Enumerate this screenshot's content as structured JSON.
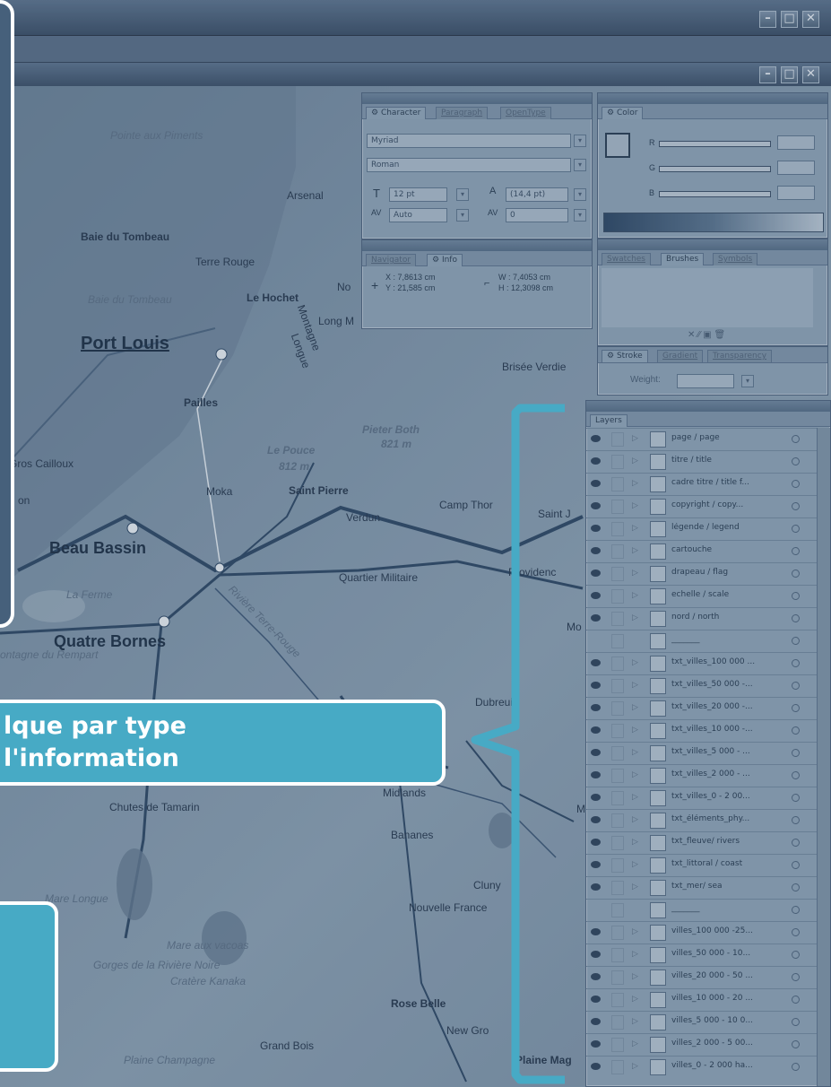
{
  "colors": {
    "accent": "#47aac5",
    "overlay": "#2e3e52"
  },
  "callout": {
    "line1": "lque par type",
    "line2": "l'information"
  },
  "panels": {
    "character": {
      "tabs": [
        "Character",
        "Paragraph",
        "OpenType"
      ],
      "font": "Myriad",
      "style": "Roman",
      "size": "12 pt",
      "leading": "(14,4 pt)",
      "kerning": "Auto",
      "tracking": "0"
    },
    "color": {
      "tab": "Color",
      "channels": [
        "R",
        "G",
        "B"
      ]
    },
    "info": {
      "tabs": [
        "Navigator",
        "Info"
      ],
      "x": "X : 7,8613 cm",
      "y": "Y : 21,585 cm",
      "w": "W : 7,4053 cm",
      "h": "H : 12,3098 cm"
    },
    "swatches": {
      "tabs": [
        "Swatches",
        "Brushes",
        "Symbols"
      ]
    },
    "stroke": {
      "tabs": [
        "Stroke",
        "Gradient",
        "Transparency"
      ],
      "weight_label": "Weight:"
    },
    "layers": {
      "tab": "Layers",
      "items": [
        "page / page",
        "titre / title",
        "cadre titre / title f...",
        "copyright / copy...",
        "légende / legend",
        "cartouche",
        "drapeau / flag",
        "echelle / scale",
        "nord / north",
        "_______",
        "txt_villes_100 000 ...",
        "txt_villes_50 000 -...",
        "txt_villes_20 000 -...",
        "txt_villes_10 000 -...",
        "txt_villes_5 000 - ...",
        "txt_villes_2 000 - ...",
        "txt_villes_0 - 2 00...",
        "txt_éléments_phy...",
        "txt_fleuve/ rivers",
        "txt_littoral / coast",
        "txt_mer/ sea",
        "_______",
        "villes_100 000 -25...",
        "villes_50 000 - 10...",
        "villes_20 000 - 50 ...",
        "villes_10 000 - 20 ...",
        "villes_5 000 - 10 0...",
        "villes_2 000 - 5 00...",
        "villes_0 - 2 000 ha..."
      ]
    }
  },
  "map_labels": [
    {
      "t": "Pointe aux Piments",
      "c": "i"
    },
    {
      "t": "Arsenal",
      "c": ""
    },
    {
      "t": "Baie du Tombeau",
      "c": "b"
    },
    {
      "t": "Terre Rouge",
      "c": ""
    },
    {
      "t": "Baie du Tombeau",
      "c": "i"
    },
    {
      "t": "Le Hochet",
      "c": "b"
    },
    {
      "t": "No",
      "c": ""
    },
    {
      "t": "Long M",
      "c": ""
    },
    {
      "t": "Port Louis",
      "c": "big"
    },
    {
      "t": "Montagne",
      "c": ""
    },
    {
      "t": "Longue",
      "c": ""
    },
    {
      "t": "Brisée Verdie",
      "c": ""
    },
    {
      "t": "Pailles",
      "c": "b"
    },
    {
      "t": "Pieter Both",
      "c": "bi"
    },
    {
      "t": "821 m",
      "c": "bi"
    },
    {
      "t": "Le Pouce",
      "c": "bi"
    },
    {
      "t": "812 m",
      "c": "bi"
    },
    {
      "t": "Gros Cailloux",
      "c": ""
    },
    {
      "t": "Moka",
      "c": ""
    },
    {
      "t": "Saint Pierre",
      "c": "b"
    },
    {
      "t": "Camp Thor",
      "c": ""
    },
    {
      "t": "Saint J",
      "c": ""
    },
    {
      "t": "Verdun",
      "c": ""
    },
    {
      "t": "Beau Bassin",
      "c": "mid"
    },
    {
      "t": "Quartier Militaire",
      "c": ""
    },
    {
      "t": "Providenc",
      "c": ""
    },
    {
      "t": "La Ferme",
      "c": "i"
    },
    {
      "t": "Mo",
      "c": ""
    },
    {
      "t": "Quatre Bornes",
      "c": "mid"
    },
    {
      "t": "ontagne du Rempart",
      "c": "i"
    },
    {
      "t": "Rivière Terre-Rouge",
      "c": "i"
    },
    {
      "t": "Dubreuil",
      "c": ""
    },
    {
      "t": "Midlands",
      "c": ""
    },
    {
      "t": "Chutes de Tamarin",
      "c": ""
    },
    {
      "t": "Bananes",
      "c": ""
    },
    {
      "t": "Mare Longue",
      "c": "i"
    },
    {
      "t": "Cluny",
      "c": ""
    },
    {
      "t": "Nouvelle France",
      "c": ""
    },
    {
      "t": "Mare aux vacoas",
      "c": "i"
    },
    {
      "t": "Gorges de la Rivière Noire",
      "c": "i"
    },
    {
      "t": "Rose Belle",
      "c": "b"
    },
    {
      "t": "Cratère Kanaka",
      "c": "i"
    },
    {
      "t": "New Gro",
      "c": ""
    },
    {
      "t": "Grand Bois",
      "c": ""
    },
    {
      "t": "Plaine Champagne",
      "c": "i"
    },
    {
      "t": "Plaine Mag",
      "c": "b"
    },
    {
      "t": "on",
      "c": ""
    },
    {
      "t": "M",
      "c": ""
    }
  ]
}
